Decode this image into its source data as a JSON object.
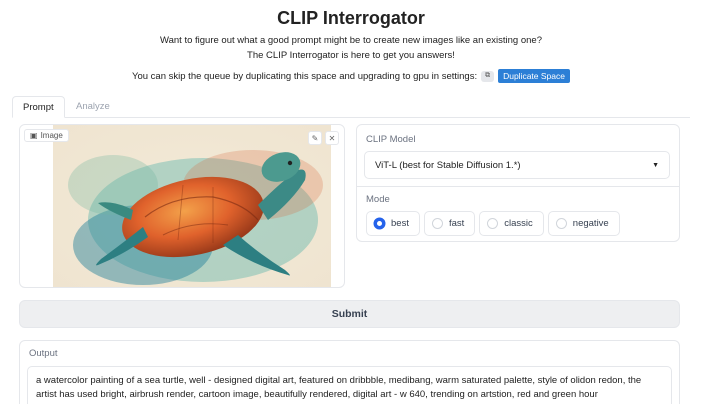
{
  "header": {
    "title": "CLIP Interrogator",
    "line1": "Want to figure out what a good prompt might be to create new images like an existing one?",
    "line2": "The CLIP Interrogator is here to get you answers!",
    "dup_text": "You can skip the queue by duplicating this space and upgrading to gpu in settings:",
    "dup_button": "Duplicate Space"
  },
  "tabs": [
    {
      "label": "Prompt",
      "active": true
    },
    {
      "label": "Analyze",
      "active": false
    }
  ],
  "image_panel": {
    "label": "Image"
  },
  "clip_model": {
    "label": "CLIP Model",
    "value": "ViT-L (best for Stable Diffusion 1.*)"
  },
  "mode": {
    "label": "Mode",
    "options": [
      "best",
      "fast",
      "classic",
      "negative"
    ],
    "selected": "best"
  },
  "submit_label": "Submit",
  "output": {
    "label": "Output",
    "text": "a watercolor painting of a sea turtle, well - designed digital art, featured on dribbble, medibang, warm saturated palette, style of olidon redon, the artist has used bright, airbrush render, cartoon image, beautifully rendered, digital art - w 640, trending on artstion, red and green hour"
  },
  "colors": {
    "accent": "#2563eb",
    "dup_button": "#2c7fd6"
  }
}
